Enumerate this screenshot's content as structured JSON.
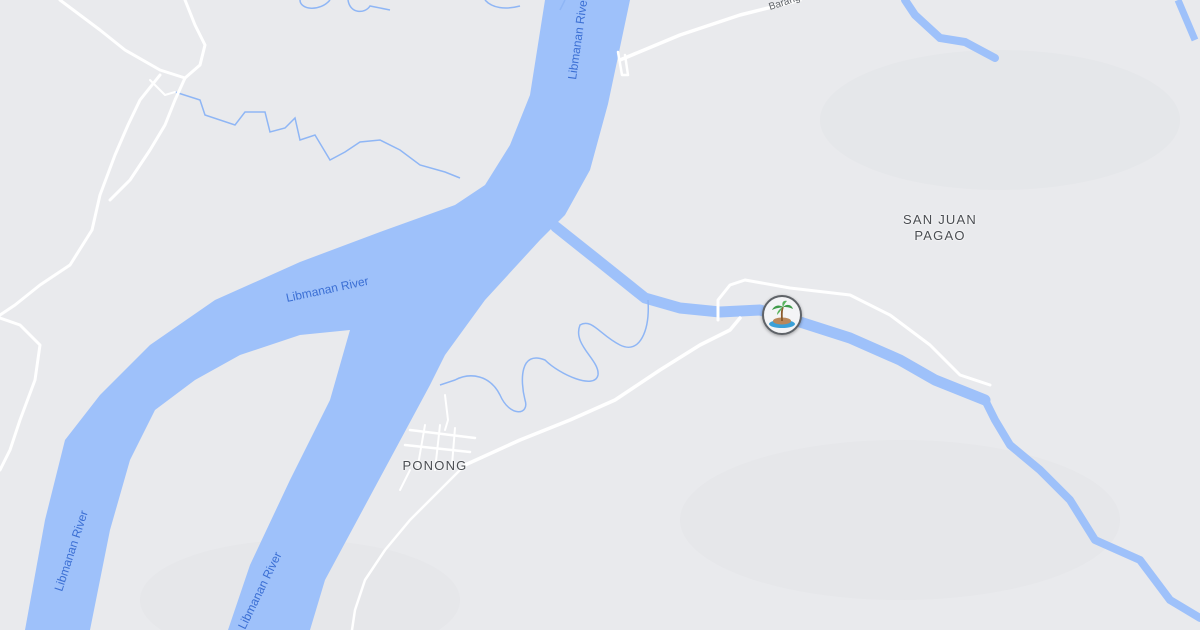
{
  "map": {
    "place_labels": {
      "san_juan_line1": "SAN JUAN",
      "san_juan_line2": "PAGAO",
      "ponong": "PONONG"
    },
    "river_labels": {
      "middle": "Libmanan River",
      "top": "Libmanan River",
      "left": "Libmanan River",
      "bottom": "Libmanan River"
    },
    "road_labels": {
      "top": "Barang"
    },
    "marker": {
      "icon": "palm-island-icon"
    },
    "colors": {
      "land": "#e9eaed",
      "water": "#9ec1fa",
      "water_label": "#3b6fd4",
      "road": "#ffffff",
      "stream": "#8fb6f5"
    }
  }
}
